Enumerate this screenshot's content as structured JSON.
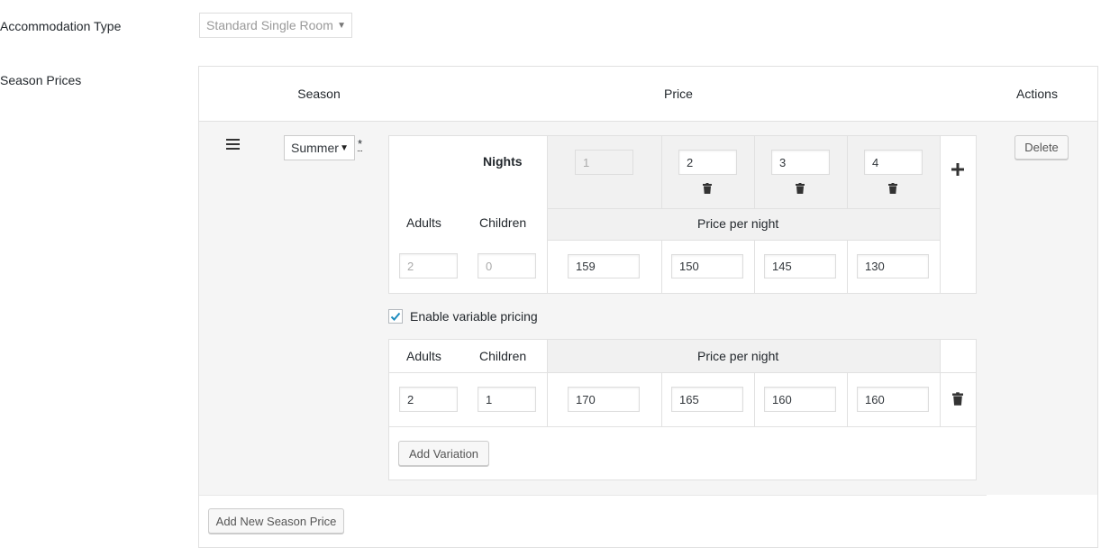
{
  "accommodation": {
    "label": "Accommodation Type",
    "selected": "Standard Single Room"
  },
  "season_prices": {
    "label": "Season Prices",
    "headers": {
      "season": "Season",
      "price": "Price",
      "actions": "Actions"
    },
    "row": {
      "season_selected": "Summer",
      "required_mark": "*",
      "delete_label": "Delete",
      "nights_label": "Nights",
      "nights": [
        "1",
        "2",
        "3",
        "4"
      ],
      "adults_label": "Adults",
      "children_label": "Children",
      "price_per_night_label": "Price per night",
      "base": {
        "adults": "2",
        "children": "0",
        "prices": [
          "159",
          "150",
          "145",
          "130"
        ]
      },
      "add_nights_symbol": "+",
      "variable_pricing": {
        "label": "Enable variable pricing",
        "checked": true
      },
      "variation_header": {
        "adults": "Adults",
        "children": "Children",
        "price_per_night": "Price per night"
      },
      "variation": {
        "adults": "2",
        "children": "1",
        "prices": [
          "170",
          "165",
          "160",
          "160"
        ]
      },
      "add_variation_label": "Add Variation"
    },
    "add_new_label": "Add New Season Price"
  },
  "icons": {
    "drag": "drag-handle-icon",
    "trash": "trash-icon",
    "plus": "plus-icon",
    "check": "check-icon"
  }
}
